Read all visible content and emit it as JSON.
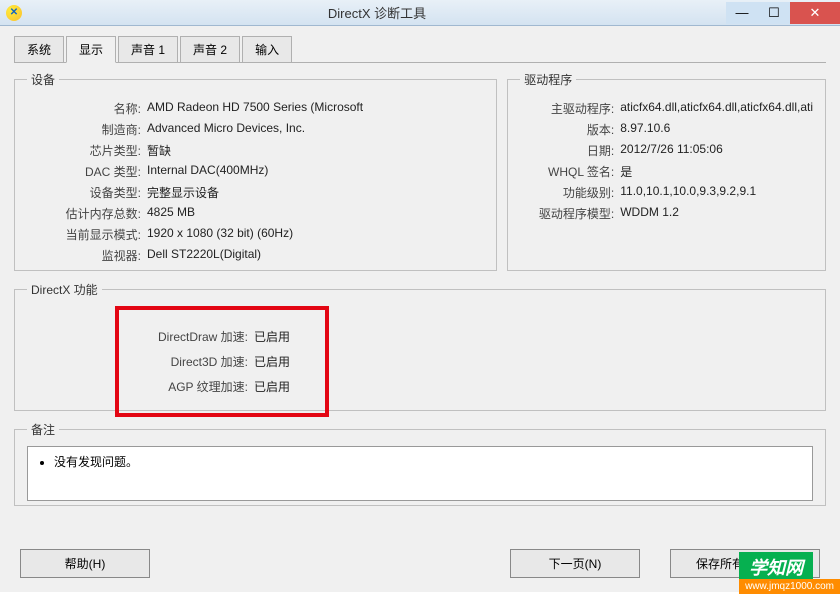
{
  "window": {
    "title": "DirectX 诊断工具"
  },
  "tabs": [
    "系统",
    "显示",
    "声音 1",
    "声音 2",
    "输入"
  ],
  "activeTab": 1,
  "deviceGroup": {
    "legend": "设备",
    "rows": [
      {
        "label": "名称:",
        "value": "AMD Radeon HD 7500 Series (Microsoft"
      },
      {
        "label": "制造商:",
        "value": "Advanced Micro Devices, Inc."
      },
      {
        "label": "芯片类型:",
        "value": "暂缺"
      },
      {
        "label": "DAC 类型:",
        "value": "Internal DAC(400MHz)"
      },
      {
        "label": "设备类型:",
        "value": "完整显示设备"
      },
      {
        "label": "估计内存总数:",
        "value": "4825 MB"
      },
      {
        "label": "当前显示模式:",
        "value": "1920 x 1080 (32 bit) (60Hz)"
      },
      {
        "label": "监视器:",
        "value": "Dell ST2220L(Digital)"
      }
    ]
  },
  "driverGroup": {
    "legend": "驱动程序",
    "rows": [
      {
        "label": "主驱动程序:",
        "value": "aticfx64.dll,aticfx64.dll,aticfx64.dll,ati"
      },
      {
        "label": "版本:",
        "value": "8.97.10.6"
      },
      {
        "label": "日期:",
        "value": "2012/7/26 11:05:06"
      },
      {
        "label": "WHQL 签名:",
        "value": "是"
      },
      {
        "label": "功能级别:",
        "value": "11.0,10.1,10.0,9.3,9.2,9.1"
      },
      {
        "label": "驱动程序模型:",
        "value": "WDDM 1.2"
      }
    ]
  },
  "dxGroup": {
    "legend": "DirectX 功能",
    "rows": [
      {
        "label": "DirectDraw 加速:",
        "value": "已启用"
      },
      {
        "label": "Direct3D 加速:",
        "value": "已启用"
      },
      {
        "label": "AGP 纹理加速:",
        "value": "已启用"
      }
    ]
  },
  "notesGroup": {
    "legend": "备注",
    "item": "没有发现问题。"
  },
  "buttons": {
    "help": "帮助(H)",
    "next": "下一页(N)",
    "saveAll": "保存所有信息(S)..."
  },
  "watermark": {
    "line1": "学知网",
    "line2": "www.jmqz1000.com"
  }
}
